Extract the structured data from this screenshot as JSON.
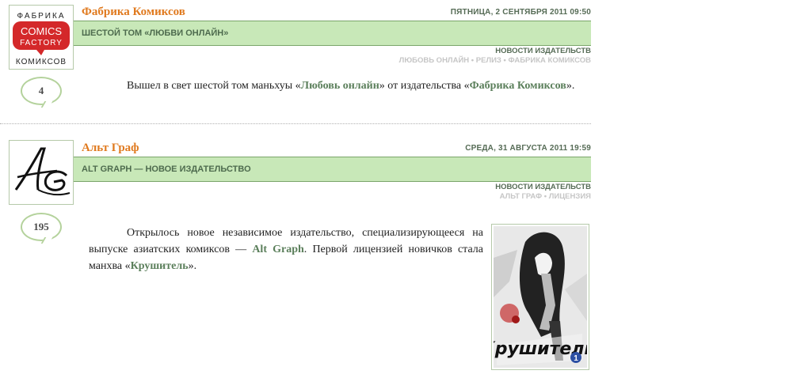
{
  "posts": [
    {
      "source": "Фабрика Комиксов",
      "date": "ПЯТНИЦА, 2 СЕНТЯБРЯ 2011 09:50",
      "title": "ШЕСТОЙ ТОМ «ЛЮБВИ ОНЛАЙН»",
      "category": "НОВОСТИ ИЗДАТЕЛЬСТВ",
      "tags": [
        "ЛЮБОВЬ ОНЛАЙН",
        "РЕЛИЗ",
        "ФАБРИКА КОМИКСОВ"
      ],
      "comments": "4",
      "logo": {
        "top": "ФАБРИКА",
        "mid1": "COMICS",
        "mid2": "FACTORY",
        "bottom": "КОМИКСОВ"
      },
      "body": {
        "p1": "Вышел в свет шестой том маньхуы «",
        "l1": "Любовь онлайн",
        "p2": "» от издательства «",
        "l2": "Фабрика Комиксов",
        "p3": "»."
      }
    },
    {
      "source": "Альт Граф",
      "date": "СРЕДА, 31 АВГУСТА 2011 19:59",
      "title": "ALT GRAPH — НОВОЕ ИЗДАТЕЛЬСТВО",
      "category": "НОВОСТИ ИЗДАТЕЛЬСТВ",
      "tags": [
        "АЛЬТ ГРАФ",
        "ЛИЦЕНЗИЯ"
      ],
      "comments": "195",
      "body": {
        "p1": "Открылось новое независимое издательство, специализирующееся на выпуске азиатских комиксов — ",
        "l1": "Alt Graph",
        "p2": ". Первой лицензией новичков стала манхва «",
        "l2": "Крушитель",
        "p3": "»."
      },
      "cover": {
        "title": "Крушитель",
        "volume": "1"
      }
    }
  ],
  "colors": {
    "accent": "#e07a1f",
    "bar": "#c8e8b8",
    "green_text": "#4e6b4e",
    "tag_gray": "#c6c6c6"
  }
}
